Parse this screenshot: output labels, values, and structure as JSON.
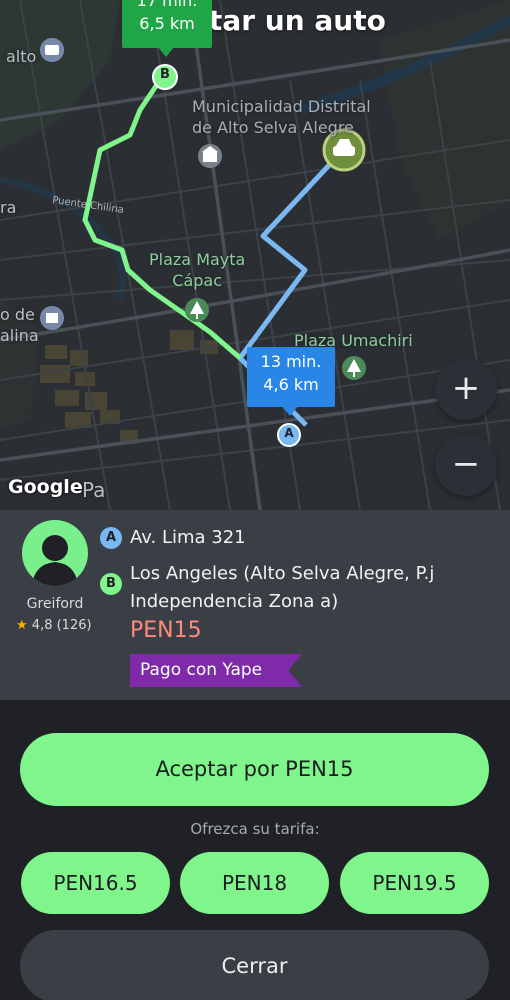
{
  "header": {
    "title": "Solicitar un auto"
  },
  "map": {
    "poi_labels": {
      "municipalidad": "Municipalidad Distrital\nde Alto Selva Alegre",
      "plaza_mayta": "Plaza Mayta\nCápac",
      "plaza_umachiri": "Plaza Umachiri",
      "alto": "alto",
      "ra": "ra",
      "o_de": "o de\nalina",
      "puente": "Puente Chilina",
      "pa": "Pa"
    },
    "route_pickup_bubble": {
      "time": "13 min.",
      "distance": "4,6 km"
    },
    "route_dest_bubble": {
      "time": "17 min.",
      "distance": "6,5 km"
    },
    "marker_a": "A",
    "marker_b": "B",
    "zoom_in": "+",
    "zoom_out": "−",
    "attribution": "Google",
    "colors": {
      "pickup_route": "#7ab8f2",
      "dest_route": "#7ff58b"
    }
  },
  "driver": {
    "name": "Greiford",
    "rating": "4,8 (126)",
    "avatar_icon": "person-silhouette-icon"
  },
  "trip": {
    "pickup_badge": "A",
    "pickup": "Av. Lima 321",
    "dest_badge": "B",
    "destination_line1": "Los Angeles (Alto Selva Alegre, P.j",
    "destination_line2": "Independencia Zona a)",
    "price": "PEN15",
    "payment_tag": "Pago con Yape"
  },
  "actions": {
    "accept_label": "Aceptar por PEN15",
    "offer_label": "Ofrezca su tarifa:",
    "fares": [
      "PEN16.5",
      "PEN18",
      "PEN19.5"
    ],
    "close_label": "Cerrar"
  }
}
